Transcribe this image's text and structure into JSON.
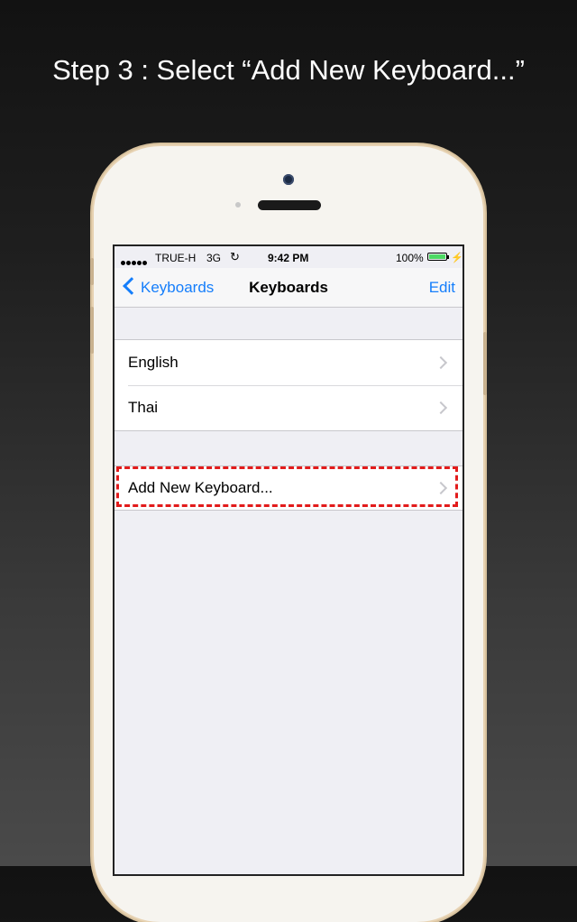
{
  "headline": "Step 3 : Select “Add New Keyboard...”",
  "status_bar": {
    "carrier": "TRUE-H",
    "network": "3G",
    "time": "9:42 PM",
    "battery": "100%",
    "sync_icon": "↻",
    "charging_icon": "⚡"
  },
  "nav_bar": {
    "back_label": "Keyboards",
    "title": "Keyboards",
    "edit_label": "Edit"
  },
  "keyboards": [
    {
      "label": "English"
    },
    {
      "label": "Thai"
    }
  ],
  "add_new_keyboard_label": "Add New Keyboard...",
  "colors": {
    "accent": "#157efb",
    "highlight": "#e21b1b",
    "battery": "#4cd964",
    "phone_body": "#f6f4ef",
    "phone_rim": "#e7d2b2"
  },
  "icons": {
    "back": "chevron-left-icon",
    "row": "chevron-right-icon",
    "battery": "battery-icon",
    "sync": "sync-icon",
    "charging": "bolt-icon"
  }
}
